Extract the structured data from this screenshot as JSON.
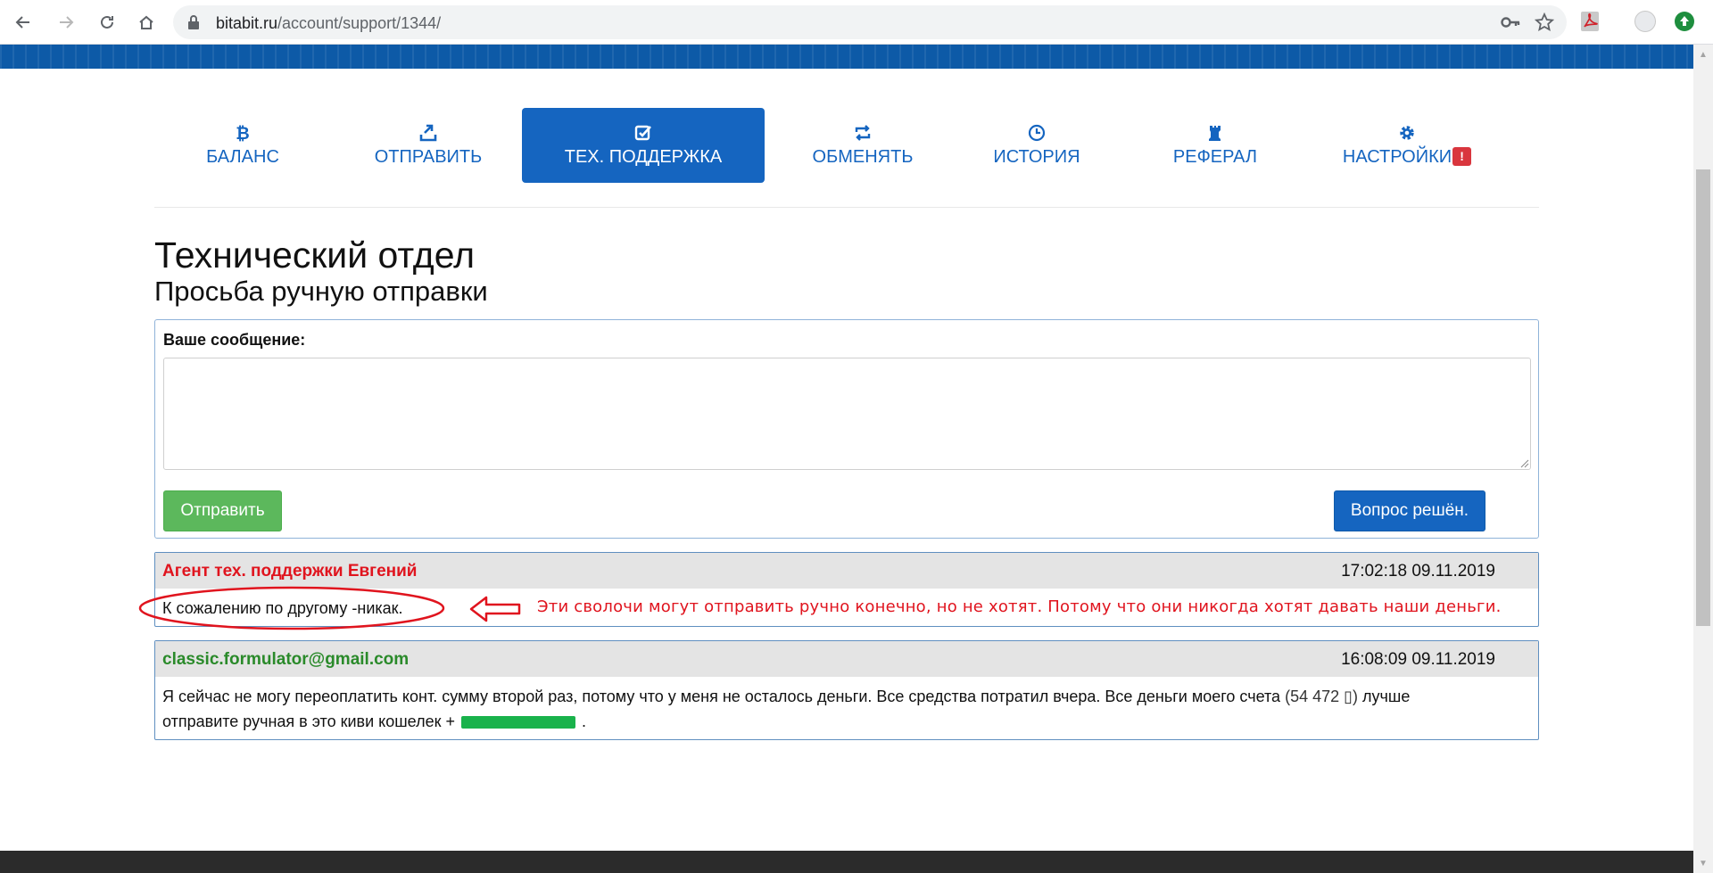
{
  "browser": {
    "url_host": "bitabit.ru",
    "url_path": "/account/support/1344/"
  },
  "tabs": [
    {
      "label": "БАЛАНС",
      "icon": "bitcoin-icon",
      "active": false
    },
    {
      "label": "ОТПРАВИТЬ",
      "icon": "send-icon",
      "active": false
    },
    {
      "label": "ТЕХ. ПОДДЕРЖКА",
      "icon": "checkbox-icon",
      "active": true
    },
    {
      "label": "ОБМЕНЯТЬ",
      "icon": "exchange-icon",
      "active": false
    },
    {
      "label": "ИСТОРИЯ",
      "icon": "clock-icon",
      "active": false
    },
    {
      "label": "РЕФЕРАЛ",
      "icon": "rook-icon",
      "active": false
    },
    {
      "label": "НАСТРОЙКИ",
      "icon": "gear-icon",
      "active": false,
      "badge": "!"
    }
  ],
  "page": {
    "title": "Технический отдел",
    "subtitle": "Просьба ручную отправки"
  },
  "form": {
    "label": "Ваше сообщение:",
    "value": "",
    "send_label": "Отправить",
    "resolved_label": "Вопрос решён."
  },
  "messages": [
    {
      "author": "Агент тех. поддержки Евгений",
      "time": "17:02:18 09.11.2019",
      "text": "К сожалению по другому -никак."
    },
    {
      "author": "classic.formulator@gmail.com",
      "time": "16:08:09 09.11.2019",
      "text_line1": "Я сейчас не могу переоплатить конт. сумму второй раз, потому что у меня не осталось деньги. Все средства потратил вчера. Все деньги моего счета",
      "amount": "(54 472 ▯)",
      "text_line1_end": "лучше",
      "text_line2": "отправите ручная в это киви кошелек +",
      "text_line2_end": "."
    }
  ],
  "annotation": {
    "text": "Эти сволочи могут отправить ручно конечно, но не хотят. Потому что они никогда хотят давать наши деньги.",
    "color": "#e0141e"
  },
  "colors": {
    "primary": "#1565c0",
    "success": "#5cb85c",
    "agent": "#e0141e",
    "user": "#2a8a2a"
  }
}
